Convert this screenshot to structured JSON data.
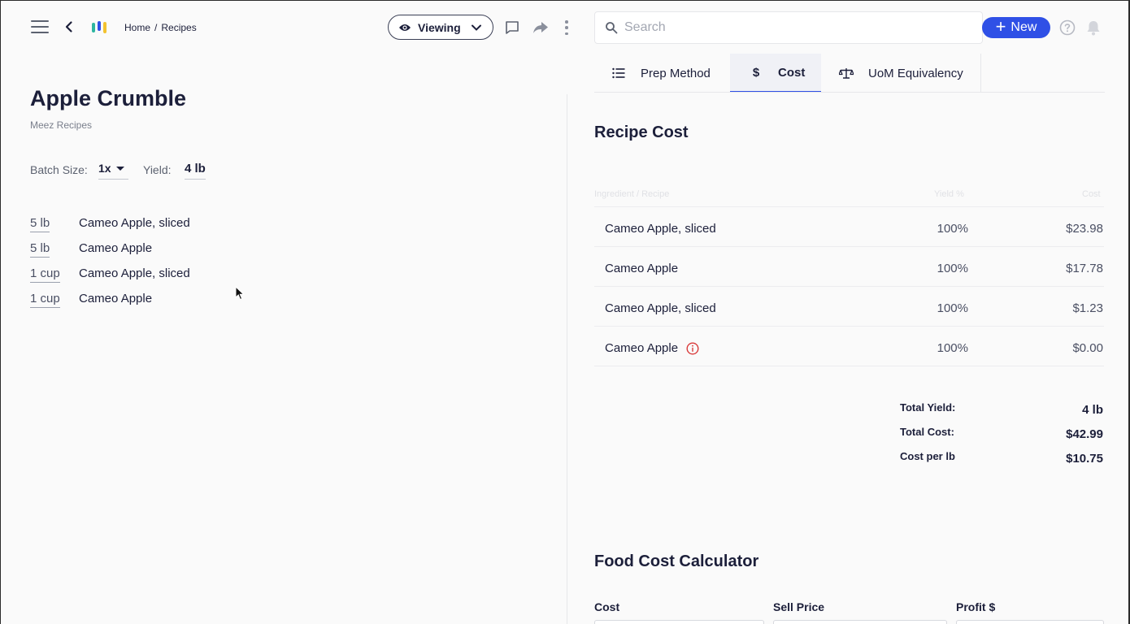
{
  "header": {
    "breadcrumb": [
      {
        "label": "Home"
      },
      {
        "label": "/"
      },
      {
        "label": "Recipes"
      }
    ],
    "viewing_label": "Viewing",
    "search_placeholder": "Search",
    "new_label": "New",
    "new_plus": "+"
  },
  "recipe": {
    "title": "Apple Crumble",
    "source": "Meez Recipes",
    "batch_label": "Batch Size:",
    "batch_value": "1x",
    "yield_label": "Yield:",
    "yield_value": "4 lb",
    "ingredients": [
      {
        "qty": "5 lb",
        "name": "Cameo Apple,  sliced"
      },
      {
        "qty": "5 lb",
        "name": "Cameo Apple"
      },
      {
        "qty": "1 cup",
        "name": "Cameo Apple,  sliced"
      },
      {
        "qty": "1 cup",
        "name": "Cameo Apple"
      }
    ]
  },
  "tabs": [
    {
      "label": "Prep Method",
      "icon": "list-icon",
      "active": false
    },
    {
      "label": "Cost",
      "icon": "dollar-icon",
      "active": true
    },
    {
      "label": "UoM Equivalency",
      "icon": "scale-icon",
      "active": false
    }
  ],
  "cost": {
    "title": "Recipe Cost",
    "columns": {
      "ingredient": "Ingredient / Recipe",
      "yield": "Yield %",
      "cost": "Cost"
    },
    "rows": [
      {
        "name": "Cameo Apple,  sliced",
        "yield": "100%",
        "cost": "$23.98",
        "warning": false
      },
      {
        "name": "Cameo Apple",
        "yield": "100%",
        "cost": "$17.78",
        "warning": false
      },
      {
        "name": "Cameo Apple,  sliced",
        "yield": "100%",
        "cost": "$1.23",
        "warning": false
      },
      {
        "name": "Cameo Apple",
        "yield": "100%",
        "cost": "$0.00",
        "warning": true
      }
    ],
    "totals": [
      {
        "label": "Total Yield:",
        "value": "4 lb"
      },
      {
        "label": "Total Cost:",
        "value": "$42.99"
      },
      {
        "label": "Cost per lb",
        "value": "$10.75"
      }
    ]
  },
  "calculator": {
    "title": "Food Cost Calculator",
    "fields": [
      {
        "label": "Cost"
      },
      {
        "label": "Sell Price"
      },
      {
        "label": "Profit $"
      }
    ]
  },
  "colors": {
    "accent": "#2f50e6",
    "text": "#1c1f3a",
    "warning": "#d93a3a"
  }
}
